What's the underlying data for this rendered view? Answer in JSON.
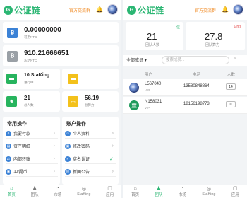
{
  "brand": {
    "logo_letter": "G",
    "name": "公证链"
  },
  "header": {
    "group_link": "官方交流群",
    "bell_icon": "bell-icon"
  },
  "left": {
    "balance1": {
      "value": "0.00000000",
      "label": "可用NTC",
      "icon": "bitcoin-icon",
      "color": "#3b82d6"
    },
    "balance2": {
      "value": "910.21666651",
      "label": "冻结NTC",
      "icon": "bitcoin-icon",
      "color": "#9aa0a6"
    },
    "stat_staking": {
      "value": "10",
      "suffix": "StaKing",
      "label": "进行中",
      "color": "#27b45e"
    },
    "stat_yellow1": {
      "color": "#f3c11b"
    },
    "stat_people": {
      "value": "21",
      "label": "总人数",
      "color": "#27b45e"
    },
    "stat_power": {
      "value": "56.19",
      "label": "总算力",
      "color": "#f3c11b"
    },
    "menu_common_title": "常用操作",
    "menu_account_title": "账户操作",
    "menu_common": [
      {
        "label": "我要付款",
        "color": "#3b82d6"
      },
      {
        "label": "资产明细",
        "color": "#3b82d6"
      },
      {
        "label": "内部转账",
        "color": "#3b82d6"
      },
      {
        "label": "冲/提币",
        "color": "#3b82d6"
      }
    ],
    "menu_account": [
      {
        "label": "个人资料",
        "color": "#3b82d6"
      },
      {
        "label": "修改密码",
        "color": "#3b82d6"
      },
      {
        "label": "实名认证",
        "color": "#3b82d6"
      },
      {
        "label": "新闻公告",
        "color": "#3b82d6"
      }
    ],
    "arrow": "›"
  },
  "right": {
    "people": {
      "value": "21",
      "label": "团队人数",
      "tag": "位",
      "tag_color": "#2bb673"
    },
    "power": {
      "value": "27.8",
      "label": "团队算力",
      "tag": "Gh/s",
      "tag_color": "#e23b3b"
    },
    "filter": {
      "selected": "全部成员",
      "caret": "▾",
      "placeholder": "搜索成员..."
    },
    "table_headers": {
      "user": "用户",
      "phone": "电话",
      "count": "人数"
    },
    "rows": [
      {
        "name": "L567040",
        "level": "VIP",
        "phone": "13580848864",
        "count": "14"
      },
      {
        "name": "N158031",
        "level": "VIP",
        "phone": "18156198773",
        "count": "0"
      }
    ]
  },
  "tabs": [
    {
      "label": "首页",
      "icon": "home-icon",
      "glyph": "⌂"
    },
    {
      "label": "团队",
      "icon": "team-icon",
      "glyph": "♟"
    },
    {
      "label": "市场",
      "icon": "market-icon",
      "glyph": "◔"
    },
    {
      "label": "StaKing",
      "icon": "staking-icon",
      "glyph": "◎"
    },
    {
      "label": "应用",
      "icon": "apps-icon",
      "glyph": "▢"
    }
  ]
}
